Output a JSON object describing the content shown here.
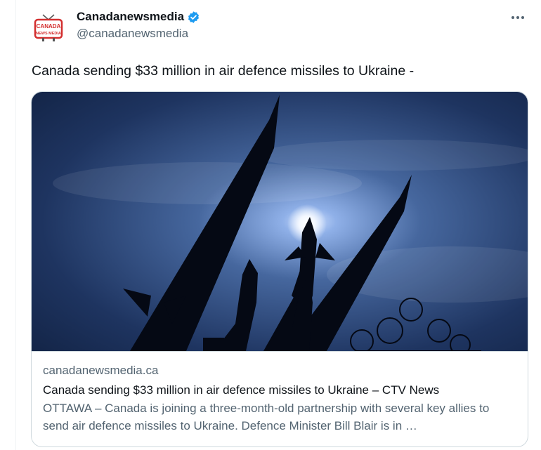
{
  "tweet": {
    "author": {
      "display_name": "Canadanewsmedia",
      "handle": "@canadanewsmedia",
      "avatar_text_top": "CANADA",
      "avatar_text_bottom": "NEWS MEDIA",
      "verified_icon": "verified-badge-icon",
      "avatar_colors": {
        "tv_red": "#d32f2f"
      }
    },
    "more_icon": "more-icon",
    "text": "Canada sending $33 million in air defence missiles to Ukraine -",
    "card": {
      "image_icon": "missiles-photo",
      "domain": "canadanewsmedia.ca",
      "title": "Canada sending $33 million in air defence missiles to Ukraine – CTV News",
      "description": "OTTAWA – Canada is joining a three-month-old partnership with several key allies to send air defence missiles to Ukraine. Defence Minister Bill Blair is in …"
    }
  },
  "colors": {
    "accent": "#1d9bf0",
    "secondary_text": "#536471",
    "border": "#cfd9de"
  }
}
